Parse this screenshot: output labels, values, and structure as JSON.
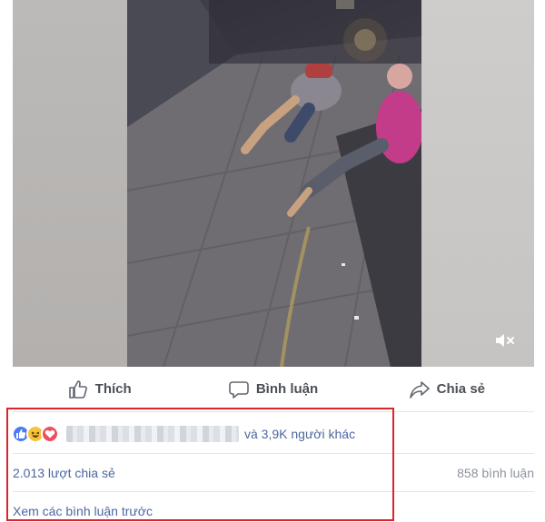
{
  "post": {
    "video": {
      "muted_icon": "speaker-muted-icon"
    },
    "actions": {
      "like_label": "Thích",
      "comment_label": "Bình luận",
      "share_label": "Chia sẻ"
    },
    "reactions": {
      "icons": [
        "like-reaction-icon",
        "haha-reaction-icon",
        "love-reaction-icon"
      ],
      "others_text": "và 3,9K người khác"
    },
    "shares_text": "2.013 lượt chia sẻ",
    "comments_text": "858 bình luận",
    "view_previous_comments": "Xem các bình luận trước"
  },
  "colors": {
    "link": "#4b67a1",
    "muted_text": "#8d949e",
    "highlight_border": "#d9252b",
    "like": "#4b7bf1",
    "haha": "#f7c33a",
    "love": "#ee4f5f"
  }
}
